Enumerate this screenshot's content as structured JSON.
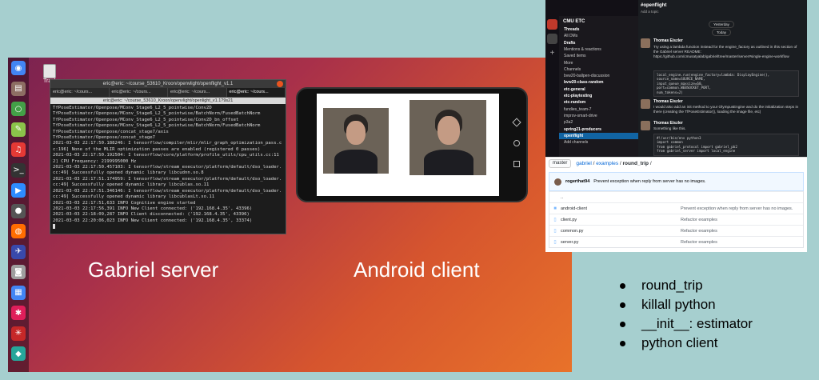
{
  "terminal": {
    "title": "eric@eric: ~/course_53610_Kroon/openvlight/openflight_v1.1",
    "tabs": [
      "eric@eric: ~/cours...",
      "eric@eric: ~/cours...",
      "eric@eric: ~/cours...",
      "eric@eric: ~/cours..."
    ],
    "path": "eric@eric: ~/course_53610_Kroon/openvlight/openlight_v1.1?9s21",
    "lines": [
      "TfPoseEstimator/Openpose/MConv_Stage6_L2_5_pointwise/Conv2D",
      "TfPoseEstimator/Openpose/MConv_Stage6_L2_5_pointwise/BatchNorm/FusedBatchNorm",
      "TfPoseEstimator/Openpose/MConv_Stage6_L2_5_pointwise/Conv2D_bn_offset",
      "TfPoseEstimator/Openpose/MConv_Stage6_L2_5_pointwise/BatchNorm/FusedBatchNorm",
      "TfPoseEstimator/Openpose/concat_stage7/axis",
      "TfPoseEstimator/Openpose/concat_stage7",
      "2021-03-03 22:17:50.188246: I tensorflow/compiler/mlir/mlir_graph_optimization_pass.cc:196] None of the MLIR optimization passes are enabled (registered 0 passes)",
      "2021-03-03 22:17:50.192504: I tensorflow/core/platform/profile_utils/cpu_utils.cc:112] CPU Frequency: 2199995000 Hz",
      "2021-03-03 22:17:50.457103: I tensorflow/stream_executor/platform/default/dso_loader.cc:49] Successfully opened dynamic library libcudnn.so.8",
      "2021-03-03 22:17:51.174959: I tensorflow/stream_executor/platform/default/dso_loader.cc:49] Successfully opened dynamic library libcublas.so.11",
      "2021-03-03 22:17:51.346146: I tensorflow/stream_executor/platform/default/dso_loader.cc:49] Successfully opened dynamic library libcublasLt.so.11",
      "2021-03-03 22:17:51,633 INFO Cognitive engine started",
      "2021-03-03 22:17:56,391 INFO New Client connected: ('192.168.4.35', 43396)",
      "2021-03-03 22:18:09,287 INFO Client disconnected: ('192.168.4.35', 43396)",
      "2021-03-03 22:20:06,023 INFO New Client connected: ('192.168.4.35', 33374)"
    ]
  },
  "desktop": {
    "trash_label": "Trash",
    "dock_icons": [
      "chrome-icon",
      "files-icon",
      "spinner-icon",
      "gedit-icon",
      "sound-icon",
      "terminal-icon",
      "zoom-icon",
      "obs-icon",
      "firefox-icon",
      "app-icon",
      "camera-icon",
      "docs-icon",
      "slack-icon",
      "spider-icon",
      "android-studio-icon"
    ]
  },
  "captions": {
    "server": "Gabriel server",
    "client": "Android client"
  },
  "slack": {
    "workspace": "CMU ETC",
    "channel": "#openflight",
    "channel_sub": "Add a topic",
    "sidebar_items": [
      "Threads",
      "All DMs",
      "Drafts",
      "Mentions & reactions",
      "Saved items",
      "More",
      "Channels",
      "bvw20-ballpen-discussion",
      "bvw20-class-random",
      "etc-general",
      "etc-playtesting",
      "etc-random",
      "fundies_team-7",
      "improv-smart-drive",
      "p3a2",
      "spring21-producers",
      "openflight",
      "Add channels"
    ],
    "date_pills": [
      "Yesterday",
      "Today"
    ],
    "messages": [
      {
        "author": "Thomas Eiszler",
        "text": "Try using a lambda function instead for the engine_factory as outlined in this section of the Gabriel server README: https://github.com/cmusatyalab/gabriel/tree/master/server#single-engine-workflow"
      },
      {
        "author": "Thomas Eiszler",
        "text": "I would also add an init method to your OlympusEngine and do the initialization steps in there (creating the TfPoseEstimator(), loading the image file, etc)"
      },
      {
        "author": "Thomas Eiszler",
        "text": "Something like this."
      }
    ],
    "code_1": [
      "local_engine.run(engine_factory=lambda: DisplayEngine(),",
      "    source_name=SOURCE_NAME,",
      "    input_queue_maxsize=60,",
      "    port=common.WEBSOCKET_PORT,",
      "    num_tokens=2)"
    ],
    "code_2": [
      "#!/usr/bin/env python3",
      "import common",
      "from gabriel_protocol import gabriel_pb2",
      "from gabriel_server import local_engine"
    ]
  },
  "github": {
    "branch": "master",
    "breadcrumb": [
      "gabriel",
      "examples",
      "round_trip",
      "/"
    ],
    "commit_author": "rogerthat94",
    "commit_msg": "Prevent exception when reply from server has no images.",
    "files": [
      {
        "name": "..",
        "msg": ""
      },
      {
        "name": "android-client",
        "msg": "Prevent exception when reply from server has no images."
      },
      {
        "name": "client.py",
        "msg": "Refactor examples"
      },
      {
        "name": "common.py",
        "msg": "Refactor examples"
      },
      {
        "name": "server.py",
        "msg": "Refactor examples"
      }
    ]
  },
  "bullets": [
    "round_trip",
    "killall python",
    "__init__: estimator",
    "python client"
  ]
}
